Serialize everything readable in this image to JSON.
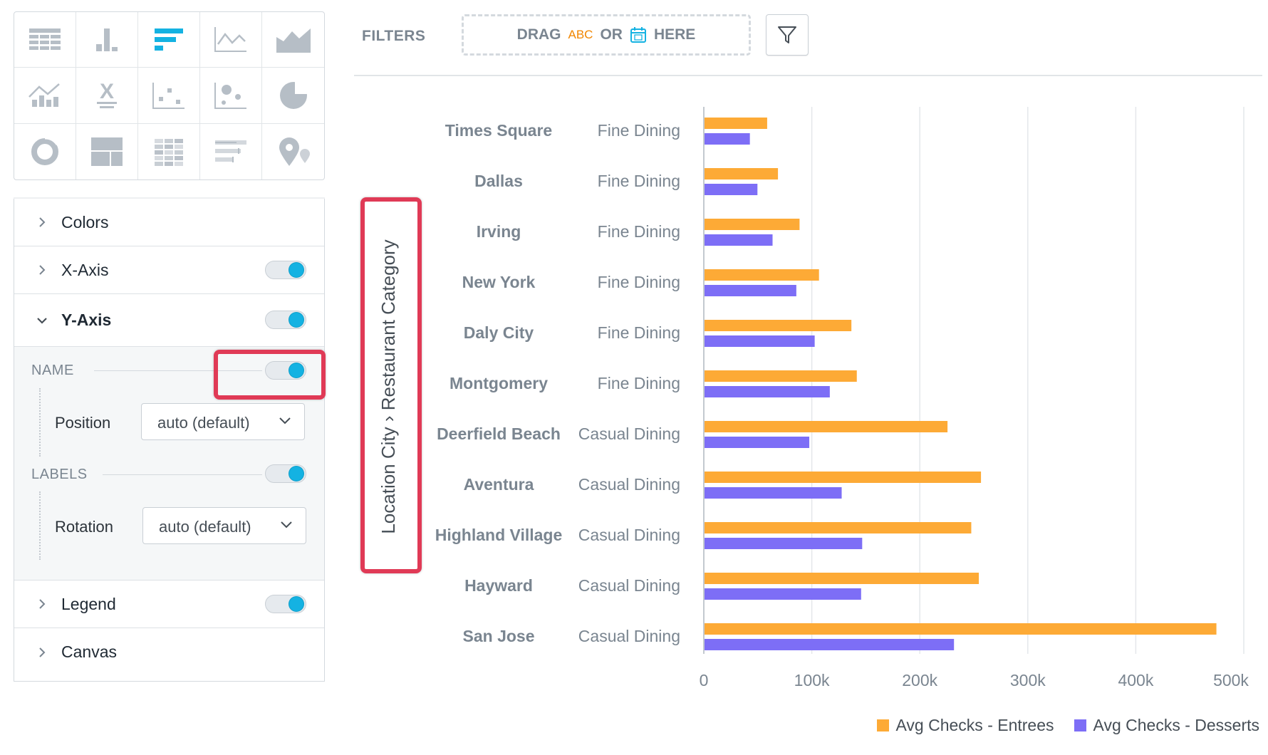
{
  "viz_types": [
    {
      "name": "table-chart-icon"
    },
    {
      "name": "column-chart-icon"
    },
    {
      "name": "bar-chart-icon",
      "active": true
    },
    {
      "name": "line-chart-icon"
    },
    {
      "name": "area-chart-icon"
    },
    {
      "name": "combo-chart-icon"
    },
    {
      "name": "headline-icon",
      "text": "X"
    },
    {
      "name": "scatter-plot-icon"
    },
    {
      "name": "bubble-chart-icon"
    },
    {
      "name": "pie-chart-icon"
    },
    {
      "name": "donut-chart-icon"
    },
    {
      "name": "treemap-icon"
    },
    {
      "name": "heatmap-icon"
    },
    {
      "name": "bullet-chart-icon"
    },
    {
      "name": "geo-chart-icon"
    }
  ],
  "colors": {
    "accent": "#14b2e2",
    "active_icon": "#14b2e2",
    "inactive_icon": "#b6bec6",
    "entrees": "#fdaa36",
    "desserts": "#7d6ef6",
    "highlight": "#e03a56"
  },
  "panel": {
    "colors_label": "Colors",
    "xaxis_label": "X-Axis",
    "yaxis_label": "Y-Axis",
    "name_label": "NAME",
    "position_label": "Position",
    "position_value": "auto (default)",
    "labels_label": "LABELS",
    "rotation_label": "Rotation",
    "rotation_value": "auto (default)",
    "legend_label": "Legend",
    "canvas_label": "Canvas"
  },
  "filters": {
    "label": "FILTERS",
    "drag": "DRAG",
    "abc": "ABC",
    "or": "OR",
    "here": "HERE"
  },
  "chart_data": {
    "type": "bar",
    "orientation": "horizontal",
    "ylabel": "Location City › Restaurant Category",
    "categories": [
      {
        "city": "Times Square",
        "category": "Fine Dining"
      },
      {
        "city": "Dallas",
        "category": "Fine Dining"
      },
      {
        "city": "Irving",
        "category": "Fine Dining"
      },
      {
        "city": "New York",
        "category": "Fine Dining"
      },
      {
        "city": "Daly City",
        "category": "Fine Dining"
      },
      {
        "city": "Montgomery",
        "category": "Fine Dining"
      },
      {
        "city": "Deerfield Beach",
        "category": "Casual Dining"
      },
      {
        "city": "Aventura",
        "category": "Casual Dining"
      },
      {
        "city": "Highland Village",
        "category": "Casual Dining"
      },
      {
        "city": "Hayward",
        "category": "Casual Dining"
      },
      {
        "city": "San Jose",
        "category": "Casual Dining"
      }
    ],
    "series": [
      {
        "name": "Avg Checks - Entrees",
        "color": "#fdaa36",
        "values": [
          58000,
          68000,
          88000,
          106000,
          136000,
          141000,
          225000,
          256000,
          247000,
          254000,
          474000
        ]
      },
      {
        "name": "Avg Checks - Desserts",
        "color": "#7d6ef6",
        "values": [
          42000,
          49000,
          63000,
          85000,
          102000,
          116000,
          97000,
          127000,
          146000,
          145000,
          231000
        ]
      }
    ],
    "xlim": [
      0,
      500000
    ],
    "xticks": [
      "0",
      "100k",
      "200k",
      "300k",
      "400k",
      "500k"
    ],
    "grid": true,
    "legend_position": "bottom-right"
  }
}
